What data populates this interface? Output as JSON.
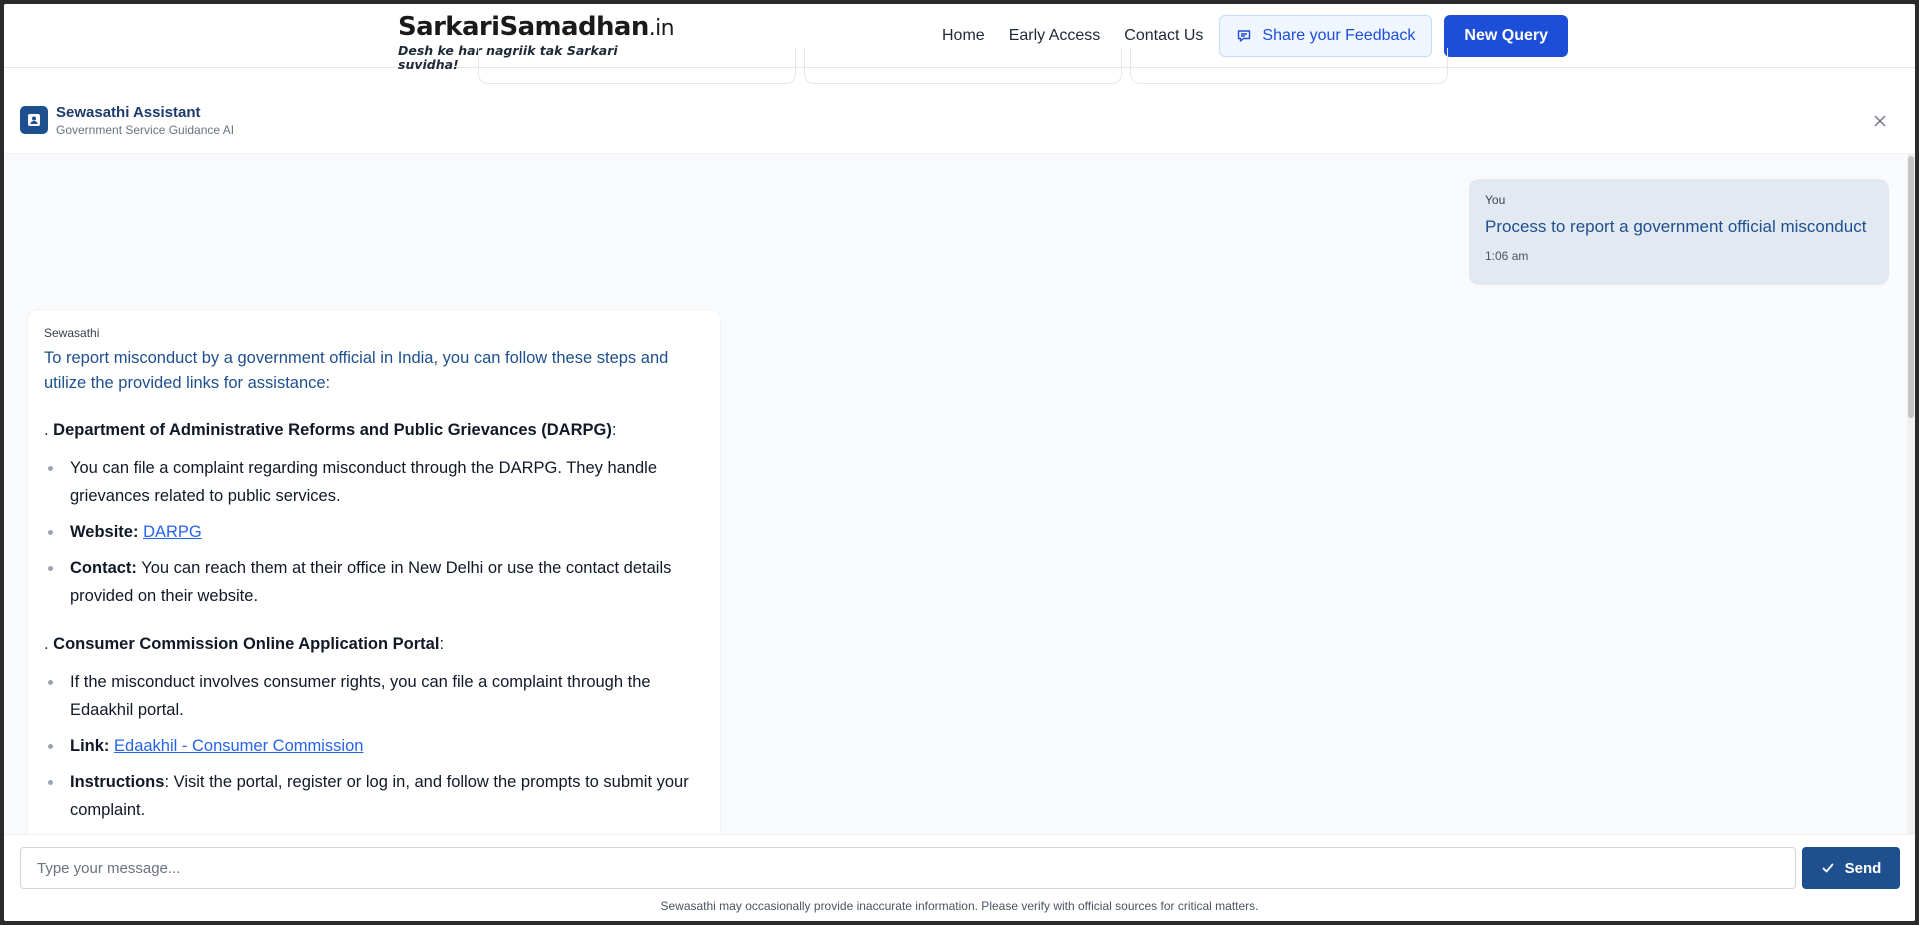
{
  "header": {
    "logo_main": "SarkariSamadhan",
    "logo_suffix": ".in",
    "logo_tagline": "Desh ke har nagriik tak Sarkari suvidha!",
    "nav": [
      "Home",
      "Early Access",
      "Contact Us"
    ],
    "feedback_label": "Share your Feedback",
    "new_query_label": "New Query",
    "accent_color": "#1d4ed8"
  },
  "assistant": {
    "title": "Sewasathi Assistant",
    "subtitle": "Government Service Guidance AI"
  },
  "messages": {
    "user": {
      "sender": "You",
      "text": "Process to report a government official misconduct",
      "time": "1:06 am"
    },
    "bot": {
      "sender": "Sewasathi",
      "intro": "To report misconduct by a government official in India, you can follow these steps and utilize the provided links for assistance:",
      "sections": [
        {
          "prefix": ". ",
          "heading": "Department of Administrative Reforms and Public Grievances (DARPG)",
          "suffix": ":",
          "items": [
            {
              "label": "",
              "text": "You can file a complaint regarding misconduct through the DARPG. They handle grievances related to public services.",
              "link": ""
            },
            {
              "label": "Website:",
              "text": "",
              "link": "DARPG"
            },
            {
              "label": "Contact:",
              "text": "You can reach them at their office in New Delhi or use the contact details provided on their website.",
              "link": ""
            }
          ]
        },
        {
          "prefix": ". ",
          "heading": "Consumer Commission Online Application Portal",
          "suffix": ":",
          "items": [
            {
              "label": "",
              "text": "If the misconduct involves consumer rights, you can file a complaint through the Edaakhil portal.",
              "link": ""
            },
            {
              "label": "Link:",
              "text": "",
              "link": "Edaakhil - Consumer Commission"
            },
            {
              "label": "Instructions",
              "text": ": Visit the portal, register or log in, and follow the prompts to submit your complaint.",
              "link": ""
            }
          ]
        }
      ]
    }
  },
  "composer": {
    "placeholder": "Type your message...",
    "value": "",
    "send_label": "Send",
    "disclaimer": "Sewasathi may occasionally provide inaccurate information. Please verify with official sources for critical matters."
  },
  "icons": {
    "feedback": "chat-bubble-icon",
    "assistant": "assistant-badge-icon",
    "close": "close-icon",
    "send": "check-icon"
  }
}
